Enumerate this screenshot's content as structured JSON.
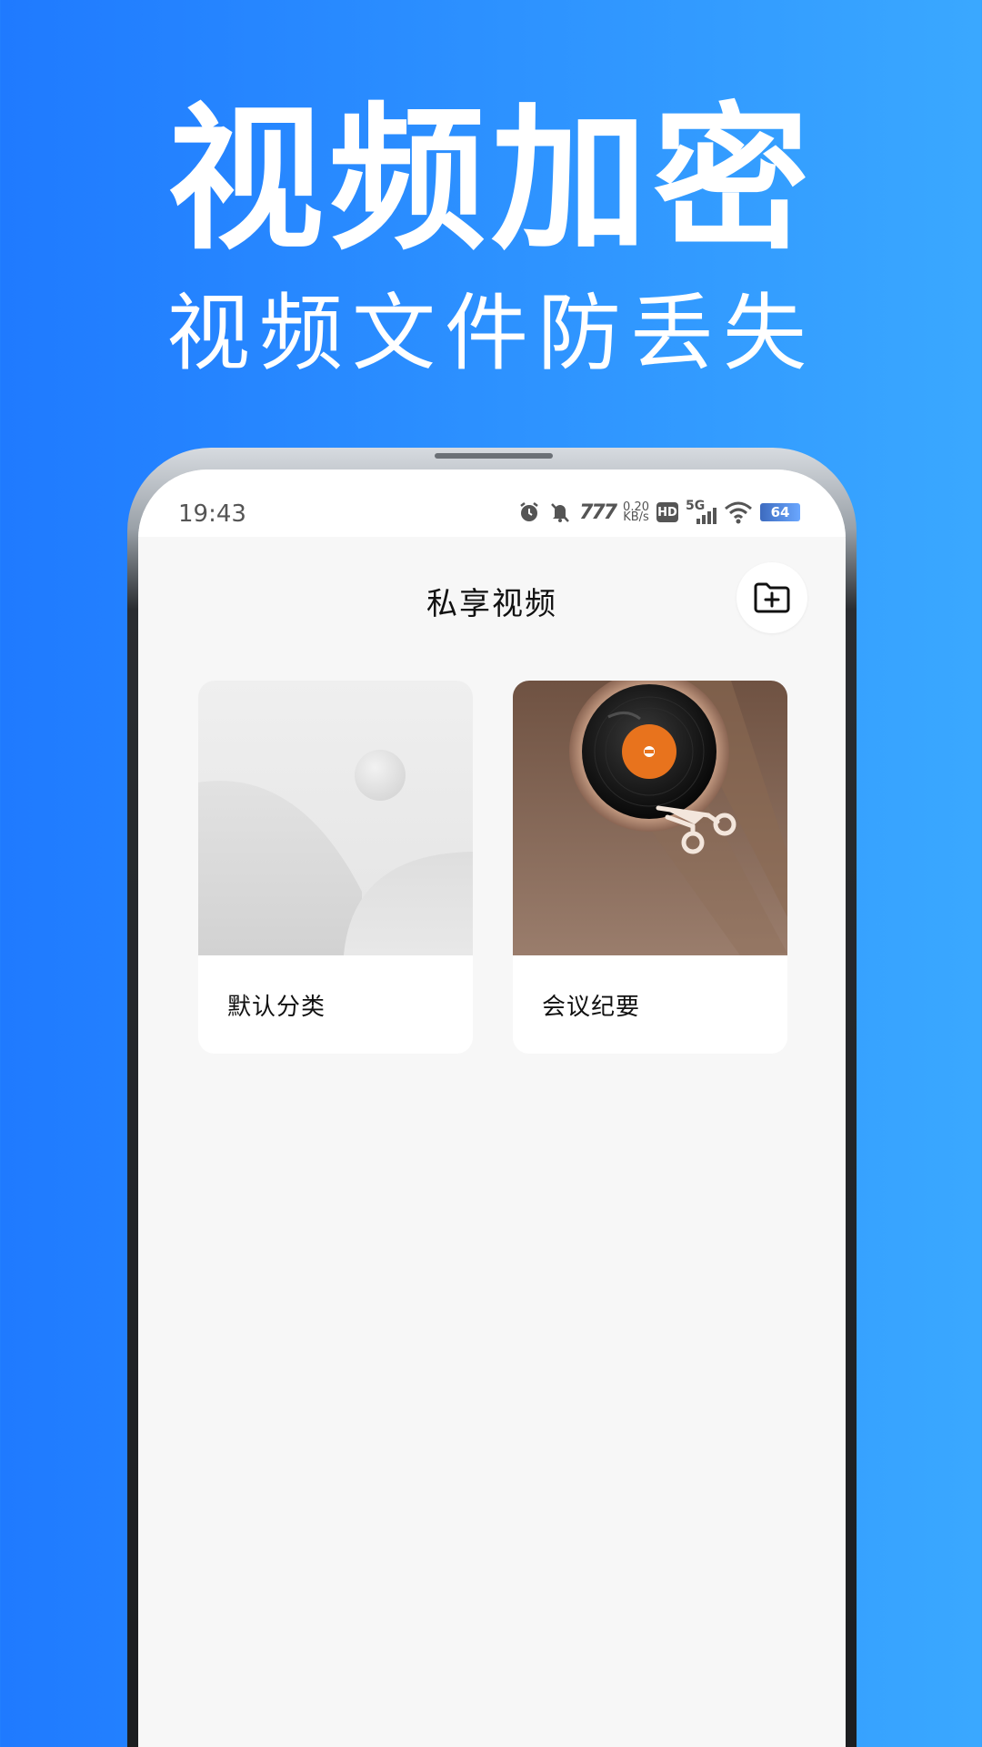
{
  "promo": {
    "title": "视频加密",
    "subtitle": "视频文件防丢失"
  },
  "status_bar": {
    "time": "19:43",
    "net_speed_value": "0.20",
    "net_speed_unit": "KB/s",
    "hd_badge": "HD",
    "network_type": "5G",
    "battery_level": "64",
    "icons": [
      "alarm-icon",
      "mute-icon",
      "sim-icon",
      "hd-icon",
      "signal-icon",
      "wifi-icon",
      "battery-icon"
    ]
  },
  "header": {
    "title": "私享视频",
    "add_button_icon": "folder-plus-icon"
  },
  "categories": [
    {
      "label": "默认分类",
      "thumbnail": "placeholder-image"
    },
    {
      "label": "会议纪要",
      "thumbnail": "vinyl-record-scissors"
    }
  ],
  "colors": {
    "background_start": "#1f7aff",
    "background_end": "#3aa8ff",
    "screen_background": "#f7f7f7",
    "accent_orange": "#e8731d"
  }
}
